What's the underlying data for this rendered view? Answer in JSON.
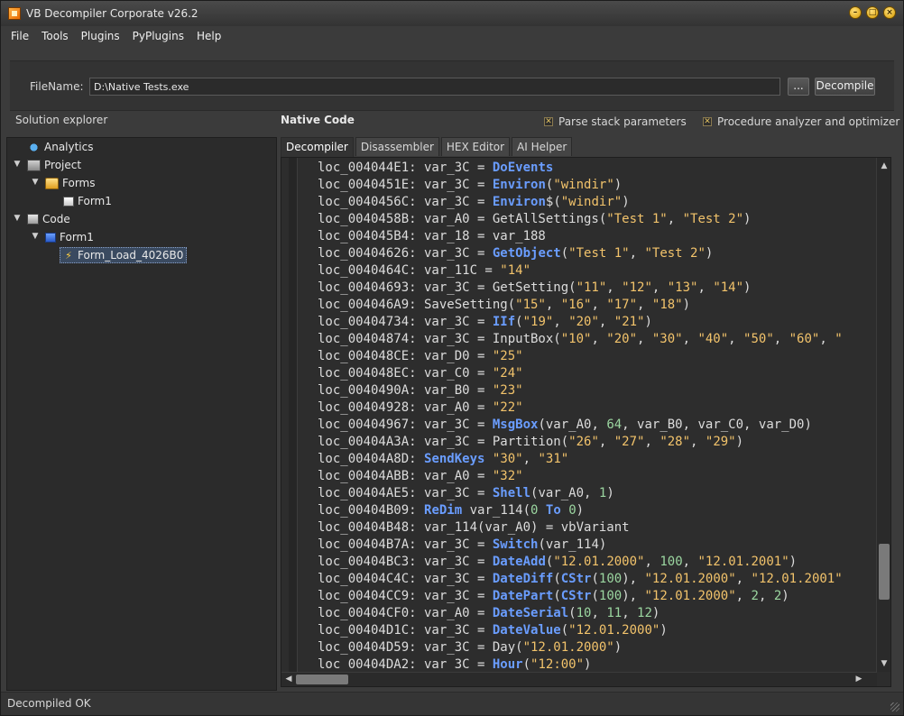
{
  "window": {
    "title": "VB Decompiler Corporate v26.2"
  },
  "menu": [
    "File",
    "Tools",
    "Plugins",
    "PyPlugins",
    "Help"
  ],
  "file": {
    "label": "FileName:",
    "value": "D:\\Native Tests.exe",
    "browse_label": "...",
    "decompile_label": "Decompile"
  },
  "solution_label": "Solution explorer",
  "native_label": "Native Code",
  "options": {
    "parse_stack": "Parse stack parameters",
    "procedure_analyzer": "Procedure analyzer and optimizer"
  },
  "tree": {
    "analytics": "Analytics",
    "project": "Project",
    "forms": "Forms",
    "form1_a": "Form1",
    "code": "Code",
    "form1_b": "Form1",
    "proc": "Form_Load_4026B0"
  },
  "tabs": [
    "Decompiler",
    "Disassembler",
    "HEX Editor",
    "AI Helper"
  ],
  "code_lines": [
    [
      [
        "t",
        "loc_004044E1: var_3C = "
      ],
      [
        "k",
        "DoEvents"
      ]
    ],
    [
      [
        "t",
        "loc_0040451E: var_3C = "
      ],
      [
        "k",
        "Environ"
      ],
      [
        "t",
        "("
      ],
      [
        "s",
        "\"windir\""
      ],
      [
        "t",
        ")"
      ]
    ],
    [
      [
        "t",
        "loc_0040456C: var_3C = "
      ],
      [
        "k",
        "Environ"
      ],
      [
        "t",
        "$("
      ],
      [
        "s",
        "\"windir\""
      ],
      [
        "t",
        ")"
      ]
    ],
    [
      [
        "t",
        "loc_0040458B: var_A0 = GetAllSettings("
      ],
      [
        "s",
        "\"Test 1\""
      ],
      [
        "t",
        ", "
      ],
      [
        "s",
        "\"Test 2\""
      ],
      [
        "t",
        ")"
      ]
    ],
    [
      [
        "t",
        "loc_004045B4: var_18 = var_188"
      ]
    ],
    [
      [
        "t",
        "loc_00404626: var_3C = "
      ],
      [
        "k",
        "GetObject"
      ],
      [
        "t",
        "("
      ],
      [
        "s",
        "\"Test 1\""
      ],
      [
        "t",
        ", "
      ],
      [
        "s",
        "\"Test 2\""
      ],
      [
        "t",
        ")"
      ]
    ],
    [
      [
        "t",
        "loc_0040464C: var_11C = "
      ],
      [
        "s",
        "\"14\""
      ]
    ],
    [
      [
        "t",
        "loc_00404693: var_3C = GetSetting("
      ],
      [
        "s",
        "\"11\""
      ],
      [
        "t",
        ", "
      ],
      [
        "s",
        "\"12\""
      ],
      [
        "t",
        ", "
      ],
      [
        "s",
        "\"13\""
      ],
      [
        "t",
        ", "
      ],
      [
        "s",
        "\"14\""
      ],
      [
        "t",
        ")"
      ]
    ],
    [
      [
        "t",
        "loc_004046A9: SaveSetting("
      ],
      [
        "s",
        "\"15\""
      ],
      [
        "t",
        ", "
      ],
      [
        "s",
        "\"16\""
      ],
      [
        "t",
        ", "
      ],
      [
        "s",
        "\"17\""
      ],
      [
        "t",
        ", "
      ],
      [
        "s",
        "\"18\""
      ],
      [
        "t",
        ")"
      ]
    ],
    [
      [
        "t",
        "loc_00404734: var_3C = "
      ],
      [
        "k",
        "IIf"
      ],
      [
        "t",
        "("
      ],
      [
        "s",
        "\"19\""
      ],
      [
        "t",
        ", "
      ],
      [
        "s",
        "\"20\""
      ],
      [
        "t",
        ", "
      ],
      [
        "s",
        "\"21\""
      ],
      [
        "t",
        ")"
      ]
    ],
    [
      [
        "t",
        "loc_00404874: var_3C = InputBox("
      ],
      [
        "s",
        "\"10\""
      ],
      [
        "t",
        ", "
      ],
      [
        "s",
        "\"20\""
      ],
      [
        "t",
        ", "
      ],
      [
        "s",
        "\"30\""
      ],
      [
        "t",
        ", "
      ],
      [
        "s",
        "\"40\""
      ],
      [
        "t",
        ", "
      ],
      [
        "s",
        "\"50\""
      ],
      [
        "t",
        ", "
      ],
      [
        "s",
        "\"60\""
      ],
      [
        "t",
        ", "
      ],
      [
        "s",
        "\""
      ]
    ],
    [
      [
        "t",
        "loc_004048CE: var_D0 = "
      ],
      [
        "s",
        "\"25\""
      ]
    ],
    [
      [
        "t",
        "loc_004048EC: var_C0 = "
      ],
      [
        "s",
        "\"24\""
      ]
    ],
    [
      [
        "t",
        "loc_0040490A: var_B0 = "
      ],
      [
        "s",
        "\"23\""
      ]
    ],
    [
      [
        "t",
        "loc_00404928: var_A0 = "
      ],
      [
        "s",
        "\"22\""
      ]
    ],
    [
      [
        "t",
        "loc_00404967: var_3C = "
      ],
      [
        "k",
        "MsgBox"
      ],
      [
        "t",
        "(var_A0, "
      ],
      [
        "n",
        "64"
      ],
      [
        "t",
        ", var_B0, var_C0, var_D0)"
      ]
    ],
    [
      [
        "t",
        "loc_00404A3A: var_3C = Partition("
      ],
      [
        "s",
        "\"26\""
      ],
      [
        "t",
        ", "
      ],
      [
        "s",
        "\"27\""
      ],
      [
        "t",
        ", "
      ],
      [
        "s",
        "\"28\""
      ],
      [
        "t",
        ", "
      ],
      [
        "s",
        "\"29\""
      ],
      [
        "t",
        ")"
      ]
    ],
    [
      [
        "t",
        "loc_00404A8D: "
      ],
      [
        "k",
        "SendKeys"
      ],
      [
        "t",
        " "
      ],
      [
        "s",
        "\"30\""
      ],
      [
        "t",
        ", "
      ],
      [
        "s",
        "\"31\""
      ]
    ],
    [
      [
        "t",
        "loc_00404ABB: var_A0 = "
      ],
      [
        "s",
        "\"32\""
      ]
    ],
    [
      [
        "t",
        "loc_00404AE5: var_3C = "
      ],
      [
        "k",
        "Shell"
      ],
      [
        "t",
        "(var_A0, "
      ],
      [
        "n",
        "1"
      ],
      [
        "t",
        ")"
      ]
    ],
    [
      [
        "t",
        "loc_00404B09: "
      ],
      [
        "k",
        "ReDim"
      ],
      [
        "t",
        " var_114("
      ],
      [
        "n",
        "0"
      ],
      [
        "t",
        " "
      ],
      [
        "k",
        "To"
      ],
      [
        "t",
        " "
      ],
      [
        "n",
        "0"
      ],
      [
        "t",
        ")"
      ]
    ],
    [
      [
        "t",
        "loc_00404B48: var_114(var_A0) = vbVariant"
      ]
    ],
    [
      [
        "t",
        "loc_00404B7A: var_3C = "
      ],
      [
        "k",
        "Switch"
      ],
      [
        "t",
        "(var_114)"
      ]
    ],
    [
      [
        "t",
        "loc_00404BC3: var_3C = "
      ],
      [
        "k",
        "DateAdd"
      ],
      [
        "t",
        "("
      ],
      [
        "s",
        "\"12.01.2000\""
      ],
      [
        "t",
        ", "
      ],
      [
        "n",
        "100"
      ],
      [
        "t",
        ", "
      ],
      [
        "s",
        "\"12.01.2001\""
      ],
      [
        "t",
        ")"
      ]
    ],
    [
      [
        "t",
        "loc_00404C4C: var_3C = "
      ],
      [
        "k",
        "DateDiff"
      ],
      [
        "t",
        "("
      ],
      [
        "k",
        "CStr"
      ],
      [
        "t",
        "("
      ],
      [
        "n",
        "100"
      ],
      [
        "t",
        "), "
      ],
      [
        "s",
        "\"12.01.2000\""
      ],
      [
        "t",
        ", "
      ],
      [
        "s",
        "\"12.01.2001\""
      ]
    ],
    [
      [
        "t",
        "loc_00404CC9: var_3C = "
      ],
      [
        "k",
        "DatePart"
      ],
      [
        "t",
        "("
      ],
      [
        "k",
        "CStr"
      ],
      [
        "t",
        "("
      ],
      [
        "n",
        "100"
      ],
      [
        "t",
        "), "
      ],
      [
        "s",
        "\"12.01.2000\""
      ],
      [
        "t",
        ", "
      ],
      [
        "n",
        "2"
      ],
      [
        "t",
        ", "
      ],
      [
        "n",
        "2"
      ],
      [
        "t",
        ")"
      ]
    ],
    [
      [
        "t",
        "loc_00404CF0: var_A0 = "
      ],
      [
        "k",
        "DateSerial"
      ],
      [
        "t",
        "("
      ],
      [
        "n",
        "10"
      ],
      [
        "t",
        ", "
      ],
      [
        "n",
        "11"
      ],
      [
        "t",
        ", "
      ],
      [
        "n",
        "12"
      ],
      [
        "t",
        ")"
      ]
    ],
    [
      [
        "t",
        "loc_00404D1C: var_3C = "
      ],
      [
        "k",
        "DateValue"
      ],
      [
        "t",
        "("
      ],
      [
        "s",
        "\"12.01.2000\""
      ],
      [
        "t",
        ")"
      ]
    ],
    [
      [
        "t",
        "loc_00404D59: var_3C = Day("
      ],
      [
        "s",
        "\"12.01.2000\""
      ],
      [
        "t",
        ")"
      ]
    ],
    [
      [
        "t",
        "loc_00404DA2: var_3C = "
      ],
      [
        "k",
        "Hour"
      ],
      [
        "t",
        "("
      ],
      [
        "s",
        "\"12:00\""
      ],
      [
        "t",
        ")"
      ]
    ]
  ],
  "status": "Decompiled OK"
}
